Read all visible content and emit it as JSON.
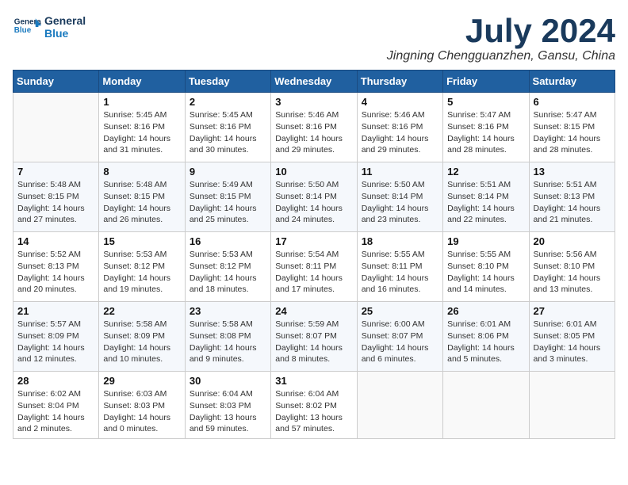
{
  "logo": {
    "line1": "General",
    "line2": "Blue"
  },
  "title": "July 2024",
  "subtitle": "Jingning Chengguanzhen, Gansu, China",
  "headers": [
    "Sunday",
    "Monday",
    "Tuesday",
    "Wednesday",
    "Thursday",
    "Friday",
    "Saturday"
  ],
  "weeks": [
    [
      {
        "day": "",
        "info": ""
      },
      {
        "day": "1",
        "info": "Sunrise: 5:45 AM\nSunset: 8:16 PM\nDaylight: 14 hours\nand 31 minutes."
      },
      {
        "day": "2",
        "info": "Sunrise: 5:45 AM\nSunset: 8:16 PM\nDaylight: 14 hours\nand 30 minutes."
      },
      {
        "day": "3",
        "info": "Sunrise: 5:46 AM\nSunset: 8:16 PM\nDaylight: 14 hours\nand 29 minutes."
      },
      {
        "day": "4",
        "info": "Sunrise: 5:46 AM\nSunset: 8:16 PM\nDaylight: 14 hours\nand 29 minutes."
      },
      {
        "day": "5",
        "info": "Sunrise: 5:47 AM\nSunset: 8:16 PM\nDaylight: 14 hours\nand 28 minutes."
      },
      {
        "day": "6",
        "info": "Sunrise: 5:47 AM\nSunset: 8:15 PM\nDaylight: 14 hours\nand 28 minutes."
      }
    ],
    [
      {
        "day": "7",
        "info": "Sunrise: 5:48 AM\nSunset: 8:15 PM\nDaylight: 14 hours\nand 27 minutes."
      },
      {
        "day": "8",
        "info": "Sunrise: 5:48 AM\nSunset: 8:15 PM\nDaylight: 14 hours\nand 26 minutes."
      },
      {
        "day": "9",
        "info": "Sunrise: 5:49 AM\nSunset: 8:15 PM\nDaylight: 14 hours\nand 25 minutes."
      },
      {
        "day": "10",
        "info": "Sunrise: 5:50 AM\nSunset: 8:14 PM\nDaylight: 14 hours\nand 24 minutes."
      },
      {
        "day": "11",
        "info": "Sunrise: 5:50 AM\nSunset: 8:14 PM\nDaylight: 14 hours\nand 23 minutes."
      },
      {
        "day": "12",
        "info": "Sunrise: 5:51 AM\nSunset: 8:14 PM\nDaylight: 14 hours\nand 22 minutes."
      },
      {
        "day": "13",
        "info": "Sunrise: 5:51 AM\nSunset: 8:13 PM\nDaylight: 14 hours\nand 21 minutes."
      }
    ],
    [
      {
        "day": "14",
        "info": "Sunrise: 5:52 AM\nSunset: 8:13 PM\nDaylight: 14 hours\nand 20 minutes."
      },
      {
        "day": "15",
        "info": "Sunrise: 5:53 AM\nSunset: 8:12 PM\nDaylight: 14 hours\nand 19 minutes."
      },
      {
        "day": "16",
        "info": "Sunrise: 5:53 AM\nSunset: 8:12 PM\nDaylight: 14 hours\nand 18 minutes."
      },
      {
        "day": "17",
        "info": "Sunrise: 5:54 AM\nSunset: 8:11 PM\nDaylight: 14 hours\nand 17 minutes."
      },
      {
        "day": "18",
        "info": "Sunrise: 5:55 AM\nSunset: 8:11 PM\nDaylight: 14 hours\nand 16 minutes."
      },
      {
        "day": "19",
        "info": "Sunrise: 5:55 AM\nSunset: 8:10 PM\nDaylight: 14 hours\nand 14 minutes."
      },
      {
        "day": "20",
        "info": "Sunrise: 5:56 AM\nSunset: 8:10 PM\nDaylight: 14 hours\nand 13 minutes."
      }
    ],
    [
      {
        "day": "21",
        "info": "Sunrise: 5:57 AM\nSunset: 8:09 PM\nDaylight: 14 hours\nand 12 minutes."
      },
      {
        "day": "22",
        "info": "Sunrise: 5:58 AM\nSunset: 8:09 PM\nDaylight: 14 hours\nand 10 minutes."
      },
      {
        "day": "23",
        "info": "Sunrise: 5:58 AM\nSunset: 8:08 PM\nDaylight: 14 hours\nand 9 minutes."
      },
      {
        "day": "24",
        "info": "Sunrise: 5:59 AM\nSunset: 8:07 PM\nDaylight: 14 hours\nand 8 minutes."
      },
      {
        "day": "25",
        "info": "Sunrise: 6:00 AM\nSunset: 8:07 PM\nDaylight: 14 hours\nand 6 minutes."
      },
      {
        "day": "26",
        "info": "Sunrise: 6:01 AM\nSunset: 8:06 PM\nDaylight: 14 hours\nand 5 minutes."
      },
      {
        "day": "27",
        "info": "Sunrise: 6:01 AM\nSunset: 8:05 PM\nDaylight: 14 hours\nand 3 minutes."
      }
    ],
    [
      {
        "day": "28",
        "info": "Sunrise: 6:02 AM\nSunset: 8:04 PM\nDaylight: 14 hours\nand 2 minutes."
      },
      {
        "day": "29",
        "info": "Sunrise: 6:03 AM\nSunset: 8:03 PM\nDaylight: 14 hours\nand 0 minutes."
      },
      {
        "day": "30",
        "info": "Sunrise: 6:04 AM\nSunset: 8:03 PM\nDaylight: 13 hours\nand 59 minutes."
      },
      {
        "day": "31",
        "info": "Sunrise: 6:04 AM\nSunset: 8:02 PM\nDaylight: 13 hours\nand 57 minutes."
      },
      {
        "day": "",
        "info": ""
      },
      {
        "day": "",
        "info": ""
      },
      {
        "day": "",
        "info": ""
      }
    ]
  ]
}
